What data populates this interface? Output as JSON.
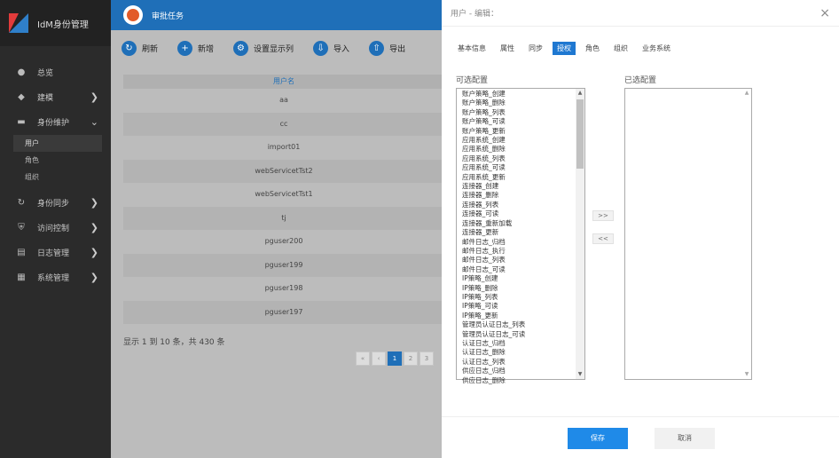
{
  "app": {
    "title": "IdM身份管理"
  },
  "sidebar": {
    "items": [
      {
        "label": "总览",
        "icon": "dashboard-icon",
        "glyph": "●",
        "arrow": ""
      },
      {
        "label": "建模",
        "icon": "cube-icon",
        "glyph": "◆",
        "arrow": "❯"
      },
      {
        "label": "身份维护",
        "icon": "id-card-icon",
        "glyph": "▬",
        "arrow": "⌄"
      }
    ],
    "subitems": [
      "用户",
      "角色",
      "组织"
    ],
    "items2": [
      {
        "label": "身份同步",
        "icon": "sync-icon",
        "glyph": "↻",
        "arrow": "❯"
      },
      {
        "label": "访问控制",
        "icon": "shield-icon",
        "glyph": "⛨",
        "arrow": "❯"
      },
      {
        "label": "日志管理",
        "icon": "log-icon",
        "glyph": "▤",
        "arrow": "❯"
      },
      {
        "label": "系统管理",
        "icon": "settings-icon",
        "glyph": "▦",
        "arrow": "❯"
      }
    ]
  },
  "topbar": {
    "label": "审批任务"
  },
  "toolbar": {
    "buttons": [
      {
        "label": "刷新",
        "glyph": "↻"
      },
      {
        "label": "新增",
        "glyph": "+"
      },
      {
        "label": "设置显示列",
        "glyph": "⚙"
      },
      {
        "label": "导入",
        "glyph": "⇩"
      },
      {
        "label": "导出",
        "glyph": "⇧"
      }
    ]
  },
  "table": {
    "header": "用户名",
    "rows": [
      "aa",
      "cc",
      "import01",
      "webServicetTst2",
      "webServicetTst1",
      "tj",
      "pguser200",
      "pguser199",
      "pguser198",
      "pguser197"
    ]
  },
  "pagination": {
    "info": "显示 1 到 10 条，共 430 条",
    "buttons": [
      "«",
      "‹",
      "1",
      "2",
      "3"
    ]
  },
  "modal": {
    "title": "用户 - 编辑：",
    "close": "×",
    "tabs": [
      "基本信息",
      "属性",
      "同步",
      "授权",
      "角色",
      "组织",
      "业务系统"
    ],
    "active_tab": 3,
    "available_label": "可选配置",
    "selected_label": "已选配置",
    "available_items": [
      "账户策略_创建",
      "账户策略_删除",
      "账户策略_列表",
      "账户策略_可读",
      "账户策略_更新",
      "应用系统_创建",
      "应用系统_删除",
      "应用系统_列表",
      "应用系统_可读",
      "应用系统_更新",
      "连接器_创建",
      "连接器_删除",
      "连接器_列表",
      "连接器_可读",
      "连接器_重新加载",
      "连接器_更新",
      "邮件日志_归档",
      "邮件日志_执行",
      "邮件日志_列表",
      "邮件日志_可读",
      "IP策略_创建",
      "IP策略_删除",
      "IP策略_列表",
      "IP策略_可读",
      "IP策略_更新",
      "管理员认证日志_列表",
      "管理员认证日志_可读",
      "认证日志_归档",
      "认证日志_删除",
      "认证日志_列表",
      "供应日志_归档",
      "供应日志_删除"
    ],
    "move_right": ">>",
    "move_left": "<<",
    "save": "保存",
    "cancel": "取消"
  },
  "colors": {
    "accent": "#1f6fb8",
    "save": "#1f8ae8",
    "sidebar": "#2b2b2b"
  }
}
